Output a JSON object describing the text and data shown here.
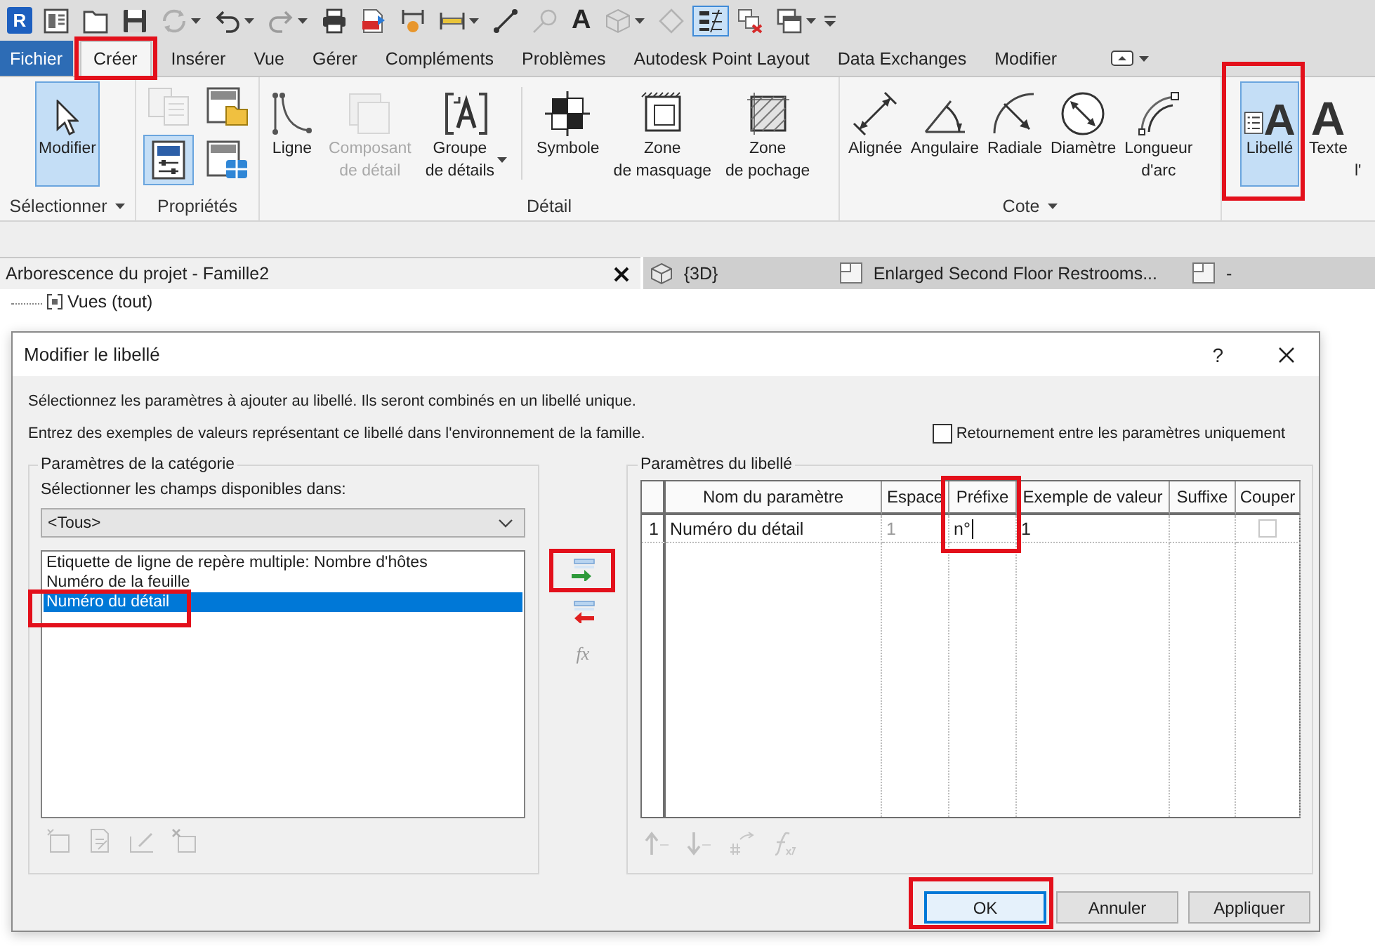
{
  "quick_access_toolbar": {
    "logo": "R",
    "items": [
      {
        "kind": "icon",
        "on": false,
        "disabled": false,
        "menu": false
      },
      {
        "kind": "icon",
        "on": false,
        "disabled": false,
        "menu": false
      },
      {
        "kind": "icon",
        "on": false,
        "disabled": false,
        "menu": false
      },
      {
        "kind": "icon",
        "on": false,
        "disabled": true,
        "menu": true
      },
      {
        "kind": "icon",
        "on": false,
        "disabled": false,
        "menu": true
      },
      {
        "kind": "icon",
        "on": false,
        "disabled": true,
        "menu": true
      },
      {
        "kind": "icon",
        "on": false,
        "disabled": false,
        "menu": false
      },
      {
        "kind": "icon",
        "on": false,
        "disabled": false,
        "menu": false
      },
      {
        "kind": "icon",
        "on": false,
        "disabled": false,
        "menu": false
      },
      {
        "kind": "icon",
        "on": false,
        "disabled": false,
        "menu": true
      },
      {
        "kind": "icon",
        "on": false,
        "disabled": false,
        "menu": false
      },
      {
        "kind": "icon",
        "on": false,
        "disabled": true,
        "menu": false
      },
      {
        "kind": "text",
        "glyph": "A",
        "on": false,
        "disabled": false,
        "menu": false
      },
      {
        "kind": "icon",
        "on": false,
        "disabled": true,
        "menu": true
      },
      {
        "kind": "icon",
        "on": false,
        "disabled": true,
        "menu": false
      },
      {
        "kind": "icon",
        "on": true,
        "disabled": false,
        "menu": false
      },
      {
        "kind": "icon",
        "on": false,
        "disabled": false,
        "menu": false
      },
      {
        "kind": "icon",
        "on": false,
        "disabled": false,
        "menu": true
      }
    ]
  },
  "ribbon": {
    "tabs": [
      {
        "label": "Fichier",
        "kind": "file",
        "selected": false,
        "highlighted": false
      },
      {
        "label": "Créer",
        "kind": "tab",
        "selected": true,
        "highlighted": true
      },
      {
        "label": "Insérer",
        "kind": "tab",
        "selected": false,
        "highlighted": false
      },
      {
        "label": "Vue",
        "kind": "tab",
        "selected": false,
        "highlighted": false
      },
      {
        "label": "Gérer",
        "kind": "tab",
        "selected": false,
        "highlighted": false
      },
      {
        "label": "Compléments",
        "kind": "tab",
        "selected": false,
        "highlighted": false
      },
      {
        "label": "Problèmes",
        "kind": "tab",
        "selected": false,
        "highlighted": false
      },
      {
        "label": "Autodesk Point Layout",
        "kind": "tab",
        "selected": false,
        "highlighted": false
      },
      {
        "label": "Data Exchanges",
        "kind": "tab",
        "selected": false,
        "highlighted": false
      },
      {
        "label": "Modifier",
        "kind": "tab",
        "selected": false,
        "highlighted": false
      }
    ],
    "panels": [
      {
        "title": "Sélectionner",
        "menu": true,
        "buttons": [
          {
            "kind": "large",
            "lines": [
              "Modifier"
            ],
            "selected": true,
            "disabled": false,
            "menu": false,
            "highlighted": false
          }
        ]
      },
      {
        "title": "Propriétés",
        "menu": false,
        "buttons": [
          {
            "kind": "small",
            "selected": false,
            "disabled": true,
            "menu": false,
            "highlighted": false
          },
          {
            "kind": "small",
            "selected": false,
            "disabled": false,
            "menu": false,
            "highlighted": false
          },
          {
            "kind": "small",
            "selected": true,
            "disabled": false,
            "menu": false,
            "highlighted": false
          },
          {
            "kind": "small",
            "selected": false,
            "disabled": false,
            "menu": false,
            "highlighted": false
          }
        ]
      },
      {
        "title": "Détail",
        "menu": false,
        "buttons": [
          {
            "kind": "large",
            "lines": [
              "Ligne"
            ],
            "selected": false,
            "disabled": false,
            "menu": false,
            "highlighted": false
          },
          {
            "kind": "large",
            "lines": [
              "Composant",
              "de détail"
            ],
            "selected": false,
            "disabled": true,
            "menu": false,
            "highlighted": false
          },
          {
            "kind": "large",
            "lines": [
              "Groupe",
              "de détails"
            ],
            "selected": false,
            "disabled": false,
            "menu": true,
            "highlighted": false
          },
          {
            "kind": "separator"
          },
          {
            "kind": "large",
            "lines": [
              "Symbole"
            ],
            "selected": false,
            "disabled": false,
            "menu": false,
            "highlighted": false
          },
          {
            "kind": "large",
            "lines": [
              "Zone",
              "de masquage"
            ],
            "selected": false,
            "disabled": false,
            "menu": false,
            "highlighted": false
          },
          {
            "kind": "large",
            "lines": [
              "Zone",
              "de pochage"
            ],
            "selected": false,
            "disabled": false,
            "menu": false,
            "highlighted": false
          }
        ]
      },
      {
        "title": "Cote",
        "menu": true,
        "buttons": [
          {
            "kind": "large",
            "lines": [
              "Alignée"
            ],
            "selected": false,
            "disabled": false,
            "menu": false,
            "highlighted": false
          },
          {
            "kind": "large",
            "lines": [
              "Angulaire"
            ],
            "selected": false,
            "disabled": false,
            "menu": false,
            "highlighted": false
          },
          {
            "kind": "large",
            "lines": [
              "Radiale"
            ],
            "selected": false,
            "disabled": false,
            "menu": false,
            "highlighted": false
          },
          {
            "kind": "large",
            "lines": [
              "Diamètre"
            ],
            "selected": false,
            "disabled": false,
            "menu": false,
            "highlighted": false
          },
          {
            "kind": "large",
            "lines": [
              "Longueur",
              "d'arc"
            ],
            "selected": false,
            "disabled": false,
            "menu": false,
            "highlighted": false
          }
        ]
      },
      {
        "buttons": [
          {
            "kind": "large",
            "glyph": "A",
            "lines": [
              "Libellé"
            ],
            "selected": true,
            "disabled": false,
            "menu": false,
            "highlighted": true
          },
          {
            "kind": "large",
            "glyph": "A",
            "lines": [
              "Texte"
            ],
            "selected": false,
            "disabled": false,
            "menu": false,
            "highlighted": false
          },
          {
            "kind": "clipped",
            "lines": [
              "l'"
            ],
            "selected": false,
            "disabled": false,
            "menu": false,
            "highlighted": false
          }
        ]
      }
    ]
  },
  "project_browser": {
    "title": "Arborescence du projet - Famille2",
    "tree": [
      {
        "label": "Vues (tout)"
      }
    ]
  },
  "view_tabs": [
    {
      "label": "{3D}",
      "selected": false
    },
    {
      "label": "Enlarged Second Floor Restrooms...",
      "selected": false
    },
    {
      "label": "-",
      "selected": false
    }
  ],
  "dialog": {
    "title": "Modifier le libellé",
    "help": "?",
    "instructions": [
      "Sélectionnez les paramètres à ajouter au libellé. Ils seront combinés en un libellé unique.",
      "Entrez des exemples de valeurs représentant ce libellé dans l'environnement de la famille."
    ],
    "flip_option": {
      "label": "Retournement entre les paramètres uniquement",
      "checked": false
    },
    "category_group": {
      "title": "Paramètres de la catégorie",
      "filter_label": "Sélectionner les champs disponibles dans:",
      "filter_value": "<Tous>",
      "fields": [
        {
          "label": "Etiquette de ligne de repère multiple: Nombre d'hôtes",
          "selected": false,
          "highlighted": false
        },
        {
          "label": "Numéro de la feuille",
          "selected": false,
          "highlighted": false
        },
        {
          "label": "Numéro du détail",
          "selected": true,
          "highlighted": true
        }
      ],
      "tools": [
        {
          "disabled": true
        },
        {
          "disabled": true
        },
        {
          "disabled": true
        },
        {
          "disabled": true
        }
      ]
    },
    "transfer_buttons": [
      {
        "kind": "add",
        "disabled": false,
        "highlighted": true
      },
      {
        "kind": "remove",
        "disabled": false,
        "highlighted": false
      },
      {
        "kind": "formula",
        "label": "fx",
        "disabled": true,
        "highlighted": false
      }
    ],
    "label_group": {
      "title": "Paramètres du libellé",
      "columns": [
        {
          "label": "Nom du paramètre",
          "highlighted": false
        },
        {
          "label": "Espace",
          "highlighted": false
        },
        {
          "label": "Préfixe",
          "highlighted": true
        },
        {
          "label": "Exemple de valeur",
          "highlighted": false
        },
        {
          "label": "Suffixe",
          "highlighted": false
        },
        {
          "label": "Couper",
          "highlighted": false
        }
      ],
      "rows": [
        {
          "number": "1",
          "cells": [
            {
              "kind": "text",
              "value": "Numéro du détail"
            },
            {
              "kind": "readonly",
              "value": "1"
            },
            {
              "kind": "input",
              "value": "n°",
              "editing": true
            },
            {
              "kind": "text",
              "value": "1"
            },
            {
              "kind": "empty"
            },
            {
              "kind": "checkbox",
              "checked": false,
              "disabled": true
            }
          ]
        }
      ],
      "tools": [
        {
          "disabled": true
        },
        {
          "disabled": true
        },
        {
          "disabled": true
        },
        {
          "disabled": true
        }
      ]
    },
    "buttons": [
      {
        "label": "OK",
        "default": true,
        "highlighted": true
      },
      {
        "label": "Annuler",
        "default": false,
        "highlighted": false
      },
      {
        "label": "Appliquer",
        "default": false,
        "highlighted": false
      }
    ]
  }
}
